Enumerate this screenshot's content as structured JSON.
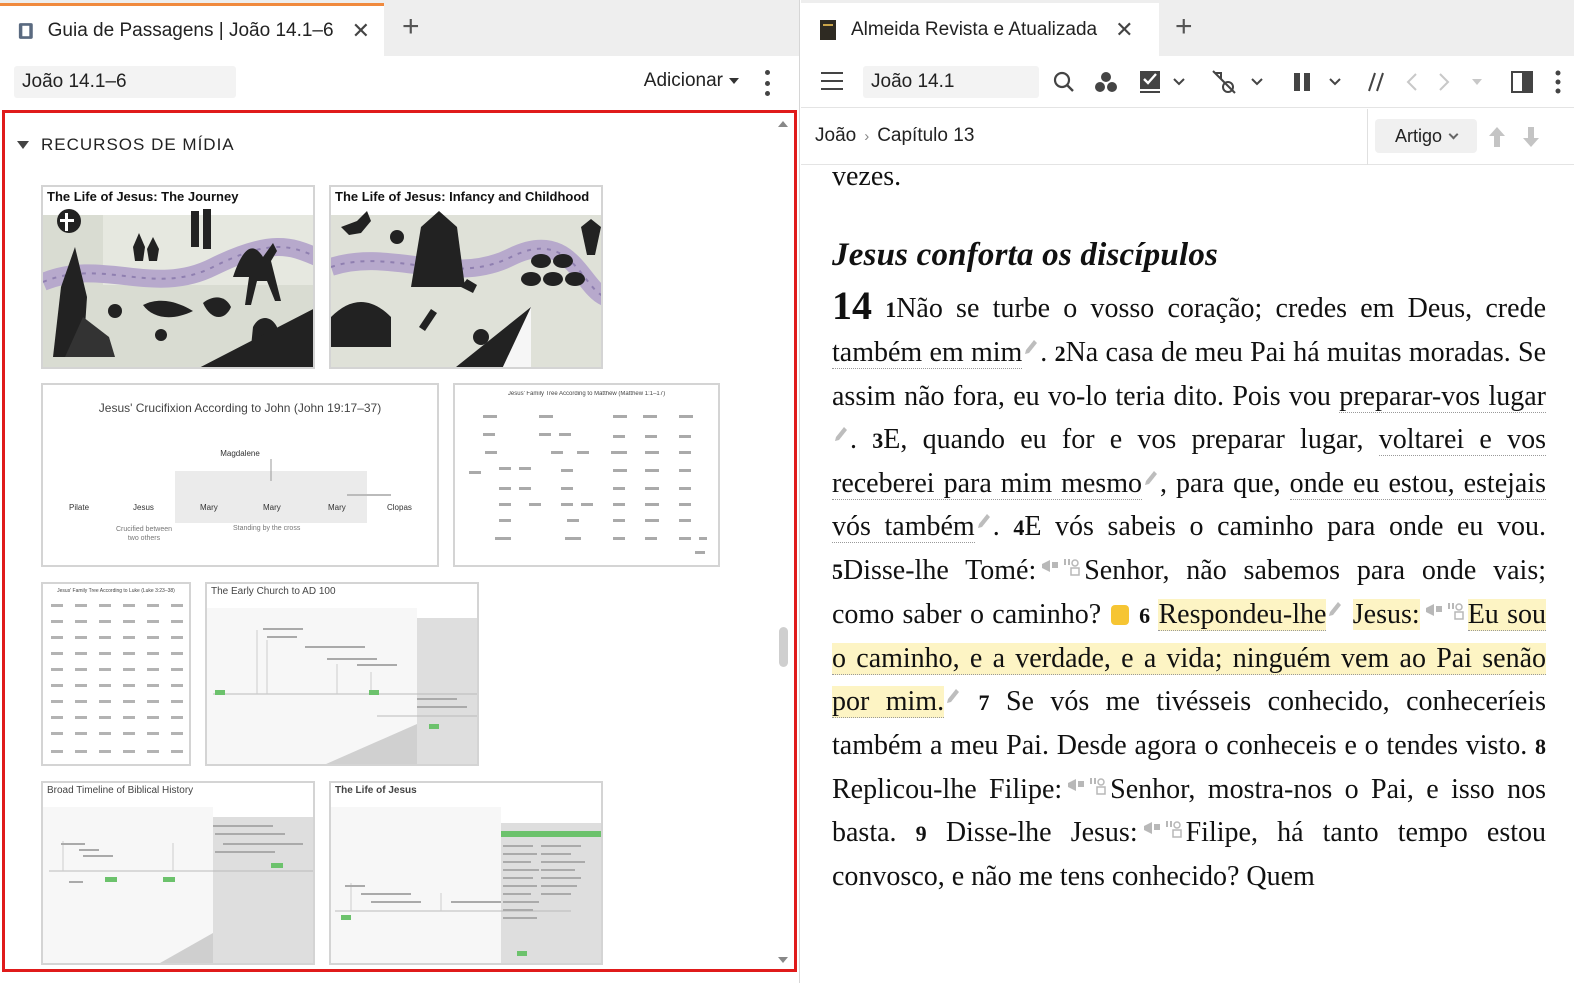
{
  "left": {
    "tab": {
      "title": "Guia de Passagens | João 14.1–6"
    },
    "reference": "João 14.1–6",
    "add_label": "Adicionar",
    "section_title": "RECURSOS DE MÍDIA",
    "thumbnails": [
      {
        "title": "The Life of Jesus: The Journey"
      },
      {
        "title": "The Life of Jesus: Infancy and Childhood"
      },
      {
        "title": "Jesus' Crucifixion According to John (John 19:17–37)",
        "labels": [
          "Magdalene",
          "Pilate",
          "Jesus",
          "Mary",
          "Mary",
          "Mary",
          "Clopas",
          "Crucified between two others",
          "Standing by the cross"
        ]
      },
      {
        "title": "Jesus' Family Tree According to Matthew (Matthew 1:1–17)"
      },
      {
        "title": "Jesus' Family Tree According to Luke (Luke 3:23–38)"
      },
      {
        "title": "The Early Church to AD 100"
      },
      {
        "title": "Broad Timeline of Biblical History"
      },
      {
        "title": "The Life of Jesus"
      }
    ]
  },
  "right": {
    "tab": {
      "title": "Almeida Revista e Atualizada"
    },
    "reference": "João 14.1",
    "breadcrumb": {
      "book": "João",
      "chapter": "Capítulo 13"
    },
    "view_mode": "Artigo",
    "text": {
      "prev_end": "vezes.",
      "heading": "Jesus conforta os discípulos",
      "chapter": "14",
      "v1n": "1",
      "v1a": "Não se turbe o vosso coração; credes em Deus, crede ",
      "v1b": "também em mim",
      "v2n": "2",
      "v2a": "Na casa de meu Pai há muitas moradas. Se assim não fora, eu vo-lo teria dito. Pois vou ",
      "v2b": "preparar-vos lugar",
      "v3n": "3",
      "v3a": "E, quando eu for e vos preparar lugar, ",
      "v3b": "voltarei e vos receberei para mim mesmo",
      "v3c": ", para que, ",
      "v3d": "onde eu estou, estejais vós também",
      "v4n": "4",
      "v4a": "E vós sabeis o caminho para onde eu vou.",
      "v5n": "5",
      "v5a": "Disse-lhe Tomé:",
      "v5b": "Senhor, não sabemos para onde vais; como saber o caminho?",
      "v6n": "6",
      "v6a": "Respondeu-lhe",
      "v6b": "Jesus:",
      "v6c": "Eu sou o caminho, e a verdade, e a vida; ninguém vem ao Pai senão por mim.",
      "v7n": "7",
      "v7a": "Se vós me tivésseis conhecido, conheceríeis também a meu Pai. Desde agora o conheceis e o tendes visto.",
      "v8n": "8",
      "v8a": "Replicou-lhe Filipe:",
      "v8b": "Senhor, mostra-nos o Pai, e isso nos basta.",
      "v9n": "9",
      "v9a": "Disse-lhe Jesus:",
      "v9b": "Filipe, há tanto tempo estou convosco, e não me tens conhecido? Quem"
    }
  },
  "colors": {
    "accent_tab": "#f08a3e",
    "selection_border": "#e01b1b",
    "highlight": "#fdf4c4",
    "note": "#f6c533"
  }
}
